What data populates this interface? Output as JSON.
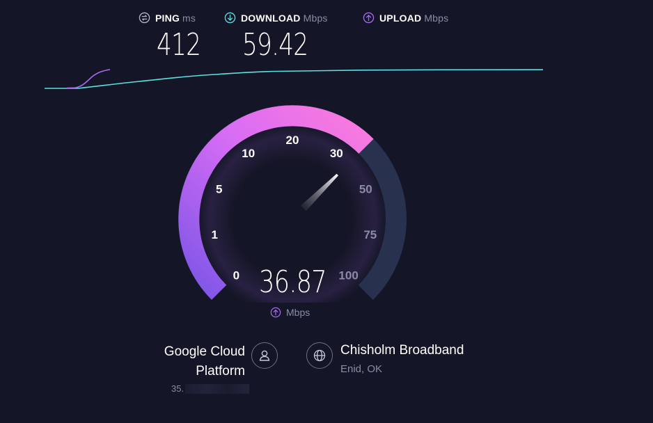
{
  "stats": {
    "ping": {
      "label": "PING",
      "unit": "ms",
      "value": "412",
      "icon": "ping-icon"
    },
    "download": {
      "label": "DOWNLOAD",
      "unit": "Mbps",
      "value": "59.42",
      "icon": "download-icon"
    },
    "upload": {
      "label": "UPLOAD",
      "unit": "Mbps",
      "value": "",
      "icon": "upload-icon"
    }
  },
  "gauge": {
    "ticks": [
      "0",
      "1",
      "5",
      "10",
      "20",
      "30",
      "50",
      "75",
      "100"
    ],
    "current_value": 36.87,
    "readout": "36.87",
    "unit": "Mbps",
    "unit_icon": "upload-icon"
  },
  "server": {
    "host_line1": "Google Cloud",
    "host_line2": "Platform",
    "host_ip_prefix": "35.",
    "host_icon": "user-icon",
    "isp_name": "Chisholm Broadband",
    "isp_location": "Enid, OK",
    "isp_icon": "globe-icon"
  },
  "colors": {
    "background": "#141526",
    "download": "#5ce0e0",
    "upload": "#a66cf0",
    "gauge_start": "#7b55e6",
    "gauge_end": "#fc7bdc",
    "gauge_track": "#28324f",
    "muted_text": "#8a8ca4"
  }
}
